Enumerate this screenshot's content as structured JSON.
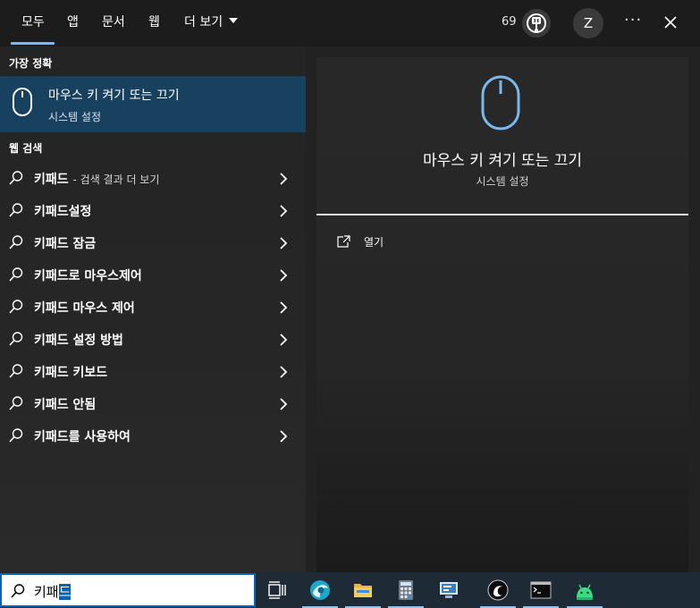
{
  "header": {
    "tabs": [
      {
        "label": "모두",
        "active": true
      },
      {
        "label": "앱"
      },
      {
        "label": "문서"
      },
      {
        "label": "웹"
      },
      {
        "label": "더 보기"
      }
    ],
    "points": "69",
    "avatar_initial": "Z",
    "more_options": "···"
  },
  "best_match": {
    "section": "가장 정확",
    "title": "마우스 키 켜기 또는 끄기",
    "subtitle": "시스템 설정",
    "icon": "mouse-icon"
  },
  "web": {
    "section": "웹 검색",
    "first_suffix": "- 검색 결과 더 보기",
    "items": [
      "키패드",
      "키패드설정",
      "키패드 잠금",
      "키패드로 마우스제어",
      "키패드 마우스 제어",
      "키패드 설정 방법",
      "키패드 키보드",
      "키패드 안됨",
      "키패드를 사용하여"
    ]
  },
  "detail": {
    "title": "마우스 키 켜기 또는 끄기",
    "subtitle": "시스템 설정",
    "actions": [
      {
        "label": "열기",
        "icon": "open-external-icon"
      }
    ]
  },
  "taskbar": {
    "search_text_prefix": "키패",
    "search_text_selected": "드",
    "apps": [
      "task-view-icon",
      "browser-icon",
      "file-explorer-icon",
      "calculator-icon",
      "remote-desktop-icon",
      "app-icon",
      "terminal-icon",
      "android-icon"
    ]
  },
  "colors": {
    "accent": "#7ab9ef",
    "selected_item": "#18405f",
    "search_border": "#0a64ad"
  }
}
